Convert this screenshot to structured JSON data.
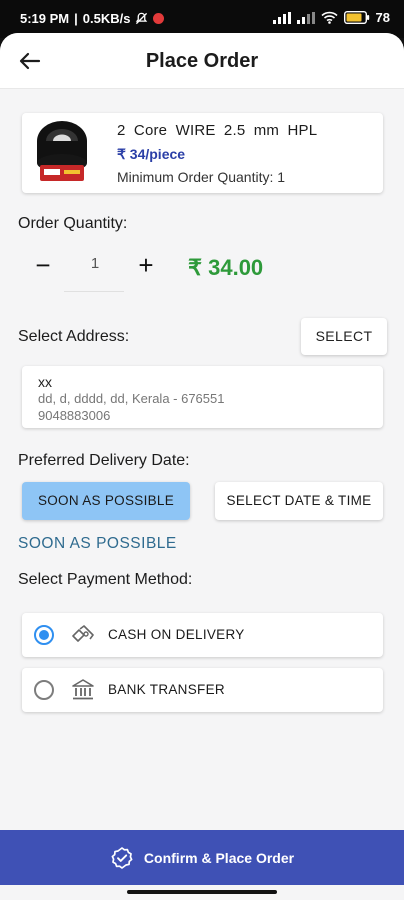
{
  "status_bar": {
    "time": "5:19 PM",
    "speed": "0.5KB/s",
    "battery": "78"
  },
  "header": {
    "title": "Place Order",
    "back_icon": "arrow-left-icon"
  },
  "product": {
    "name": "2 Core WIRE 2.5 mm HPL",
    "price": "₹ 34/piece",
    "min_order": "Minimum Order Quantity: 1"
  },
  "order_quantity": {
    "label": "Order Quantity:",
    "decrement": "−",
    "value": "1",
    "increment": "+",
    "total": "₹ 34.00"
  },
  "address": {
    "label": "Select Address:",
    "select_button": "SELECT",
    "name": "xx",
    "line": "dd, d, dddd, dd, Kerala - 676551",
    "phone": "9048883006"
  },
  "delivery": {
    "label": "Preferred Delivery Date:",
    "soon_button": "SOON AS POSSIBLE",
    "select_datetime_button": "SELECT DATE & TIME",
    "selected_value": "SOON AS POSSIBLE"
  },
  "payment": {
    "label": "Select Payment Method:",
    "options": [
      {
        "label": "CASH ON DELIVERY",
        "icon": "cash-hand-icon",
        "selected": true
      },
      {
        "label": "BANK TRANSFER",
        "icon": "bank-icon",
        "selected": false
      }
    ]
  },
  "footer": {
    "confirm_label": "Confirm & Place Order",
    "icon": "check-circle-icon"
  },
  "colors": {
    "accent": "#3f51b5",
    "price_blue": "#2b3fa7",
    "total_green": "#2e9a3a",
    "selected_chip": "#8ec5f5",
    "radio_active": "#2f8ff0"
  }
}
